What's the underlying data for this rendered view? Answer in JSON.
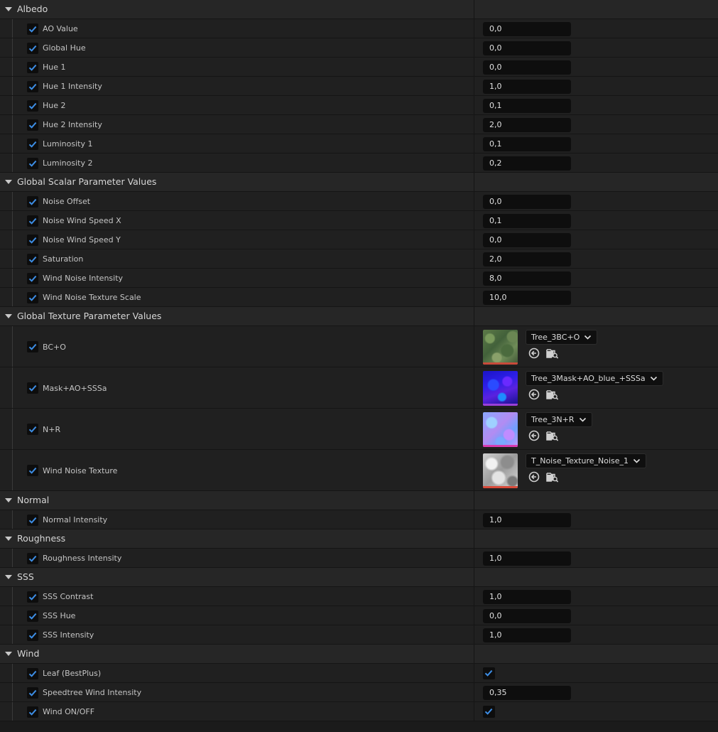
{
  "categories": [
    {
      "name": "Albedo",
      "rows": [
        {
          "label": "AO Value",
          "value": "0,0"
        },
        {
          "label": "Global Hue",
          "value": "0,0"
        },
        {
          "label": "Hue 1",
          "value": "0,0"
        },
        {
          "label": "Hue 1 Intensity",
          "value": "1,0"
        },
        {
          "label": "Hue 2",
          "value": "0,1"
        },
        {
          "label": "Hue 2 Intensity",
          "value": "2,0"
        },
        {
          "label": "Luminosity 1",
          "value": "0,1"
        },
        {
          "label": "Luminosity 2",
          "value": "0,2"
        }
      ]
    },
    {
      "name": "Global Scalar Parameter Values",
      "rows": [
        {
          "label": "Noise Offset",
          "value": "0,0"
        },
        {
          "label": "Noise Wind Speed X",
          "value": "0,1"
        },
        {
          "label": "Noise Wind Speed Y",
          "value": "0,0"
        },
        {
          "label": "Saturation",
          "value": "2,0"
        },
        {
          "label": "Wind Noise Intensity",
          "value": "8,0"
        },
        {
          "label": "Wind Noise Texture Scale",
          "value": "10,0"
        }
      ]
    },
    {
      "name": "Global Texture Parameter Values",
      "rows": [
        {
          "label": "BC+O",
          "texture": "Tree_3BC+O",
          "thumb": "bco"
        },
        {
          "label": "Mask+AO+SSSa",
          "texture": "Tree_3Mask+AO_blue_+SSSa",
          "thumb": "mask"
        },
        {
          "label": "N+R",
          "texture": "Tree_3N+R",
          "thumb": "normal"
        },
        {
          "label": "Wind Noise Texture",
          "texture": "T_Noise_Texture_Noise_1",
          "thumb": "noise"
        }
      ]
    },
    {
      "name": "Normal",
      "rows": [
        {
          "label": "Normal Intensity",
          "value": "1,0"
        }
      ]
    },
    {
      "name": "Roughness",
      "rows": [
        {
          "label": "Roughness Intensity",
          "value": "1,0"
        }
      ]
    },
    {
      "name": "SSS",
      "rows": [
        {
          "label": "SSS Contrast",
          "value": "1,0"
        },
        {
          "label": "SSS Hue",
          "value": "0,0"
        },
        {
          "label": "SSS Intensity",
          "value": "1,0"
        }
      ]
    },
    {
      "name": "Wind",
      "rows": [
        {
          "label": "Leaf (BestPlus)",
          "checked": true
        },
        {
          "label": "Speedtree Wind Intensity",
          "value": "0,35"
        },
        {
          "label": "Wind ON/OFF",
          "checked": true
        }
      ]
    }
  ],
  "icons": {
    "collapse": "triangle-down-icon",
    "enabled": "checkmark-icon",
    "use_selected": "arrow-left-circle-icon",
    "browse": "folder-search-icon",
    "dropdown": "chevron-down-icon"
  },
  "colors": {
    "checkmark": "#3d8ee6",
    "background": "#1b1b1b",
    "row": "#202020",
    "category": "#262626",
    "field": "#0e0e0e"
  }
}
